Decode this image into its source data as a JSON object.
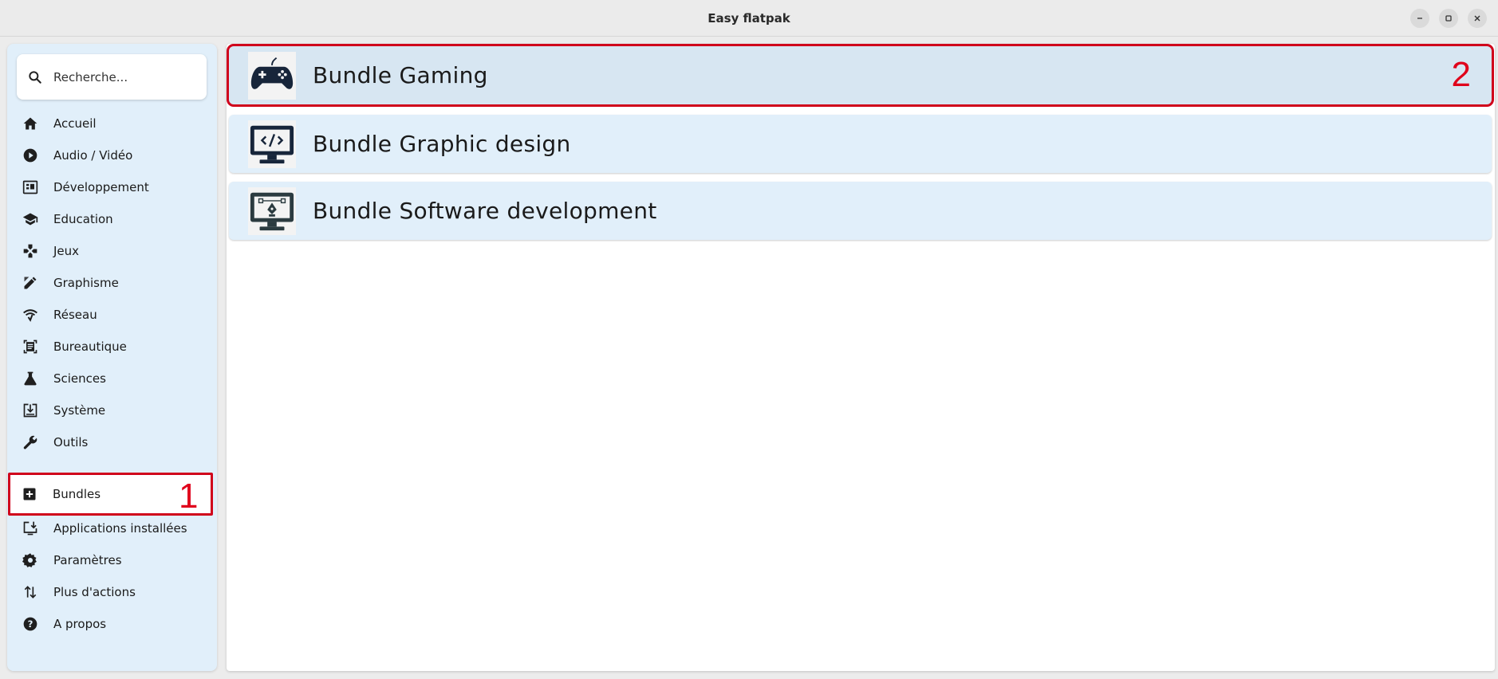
{
  "window": {
    "title": "Easy flatpak",
    "minimize_label": "–",
    "maximize_label": "□",
    "close_label": "×"
  },
  "sidebar": {
    "search_placeholder": "Recherche...",
    "items": [
      {
        "label": "Accueil",
        "icon": "home-icon"
      },
      {
        "label": "Audio / Vidéo",
        "icon": "play-circle-icon"
      },
      {
        "label": "Développement",
        "icon": "code-icon"
      },
      {
        "label": "Education",
        "icon": "school-icon"
      },
      {
        "label": "Jeux",
        "icon": "gamepad-icon"
      },
      {
        "label": "Graphisme",
        "icon": "design-icon"
      },
      {
        "label": "Réseau",
        "icon": "network-icon"
      },
      {
        "label": "Bureautique",
        "icon": "document-icon"
      },
      {
        "label": "Sciences",
        "icon": "flask-icon"
      },
      {
        "label": "Système",
        "icon": "system-icon"
      },
      {
        "label": "Outils",
        "icon": "wrench-icon"
      }
    ],
    "bottom_items": [
      {
        "label": "Bundles",
        "icon": "add-box-icon",
        "active": true
      },
      {
        "label": "Applications installées",
        "icon": "installed-icon"
      },
      {
        "label": "Paramètres",
        "icon": "gear-icon"
      },
      {
        "label": "Plus d'actions",
        "icon": "swap-icon"
      },
      {
        "label": "A propos",
        "icon": "help-icon"
      }
    ]
  },
  "annotations": {
    "marker_1": "1",
    "marker_2": "2"
  },
  "bundles": [
    {
      "name": "Bundle Gaming",
      "icon": "gamepad-icon",
      "selected": true
    },
    {
      "name": "Bundle Graphic design",
      "icon": "monitor-code-icon"
    },
    {
      "name": "Bundle Software development",
      "icon": "monitor-pen-icon"
    }
  ],
  "colors": {
    "sidebar_bg": "#e1effa",
    "highlight_border": "#d0021b",
    "annotation_text": "#e0001b"
  }
}
